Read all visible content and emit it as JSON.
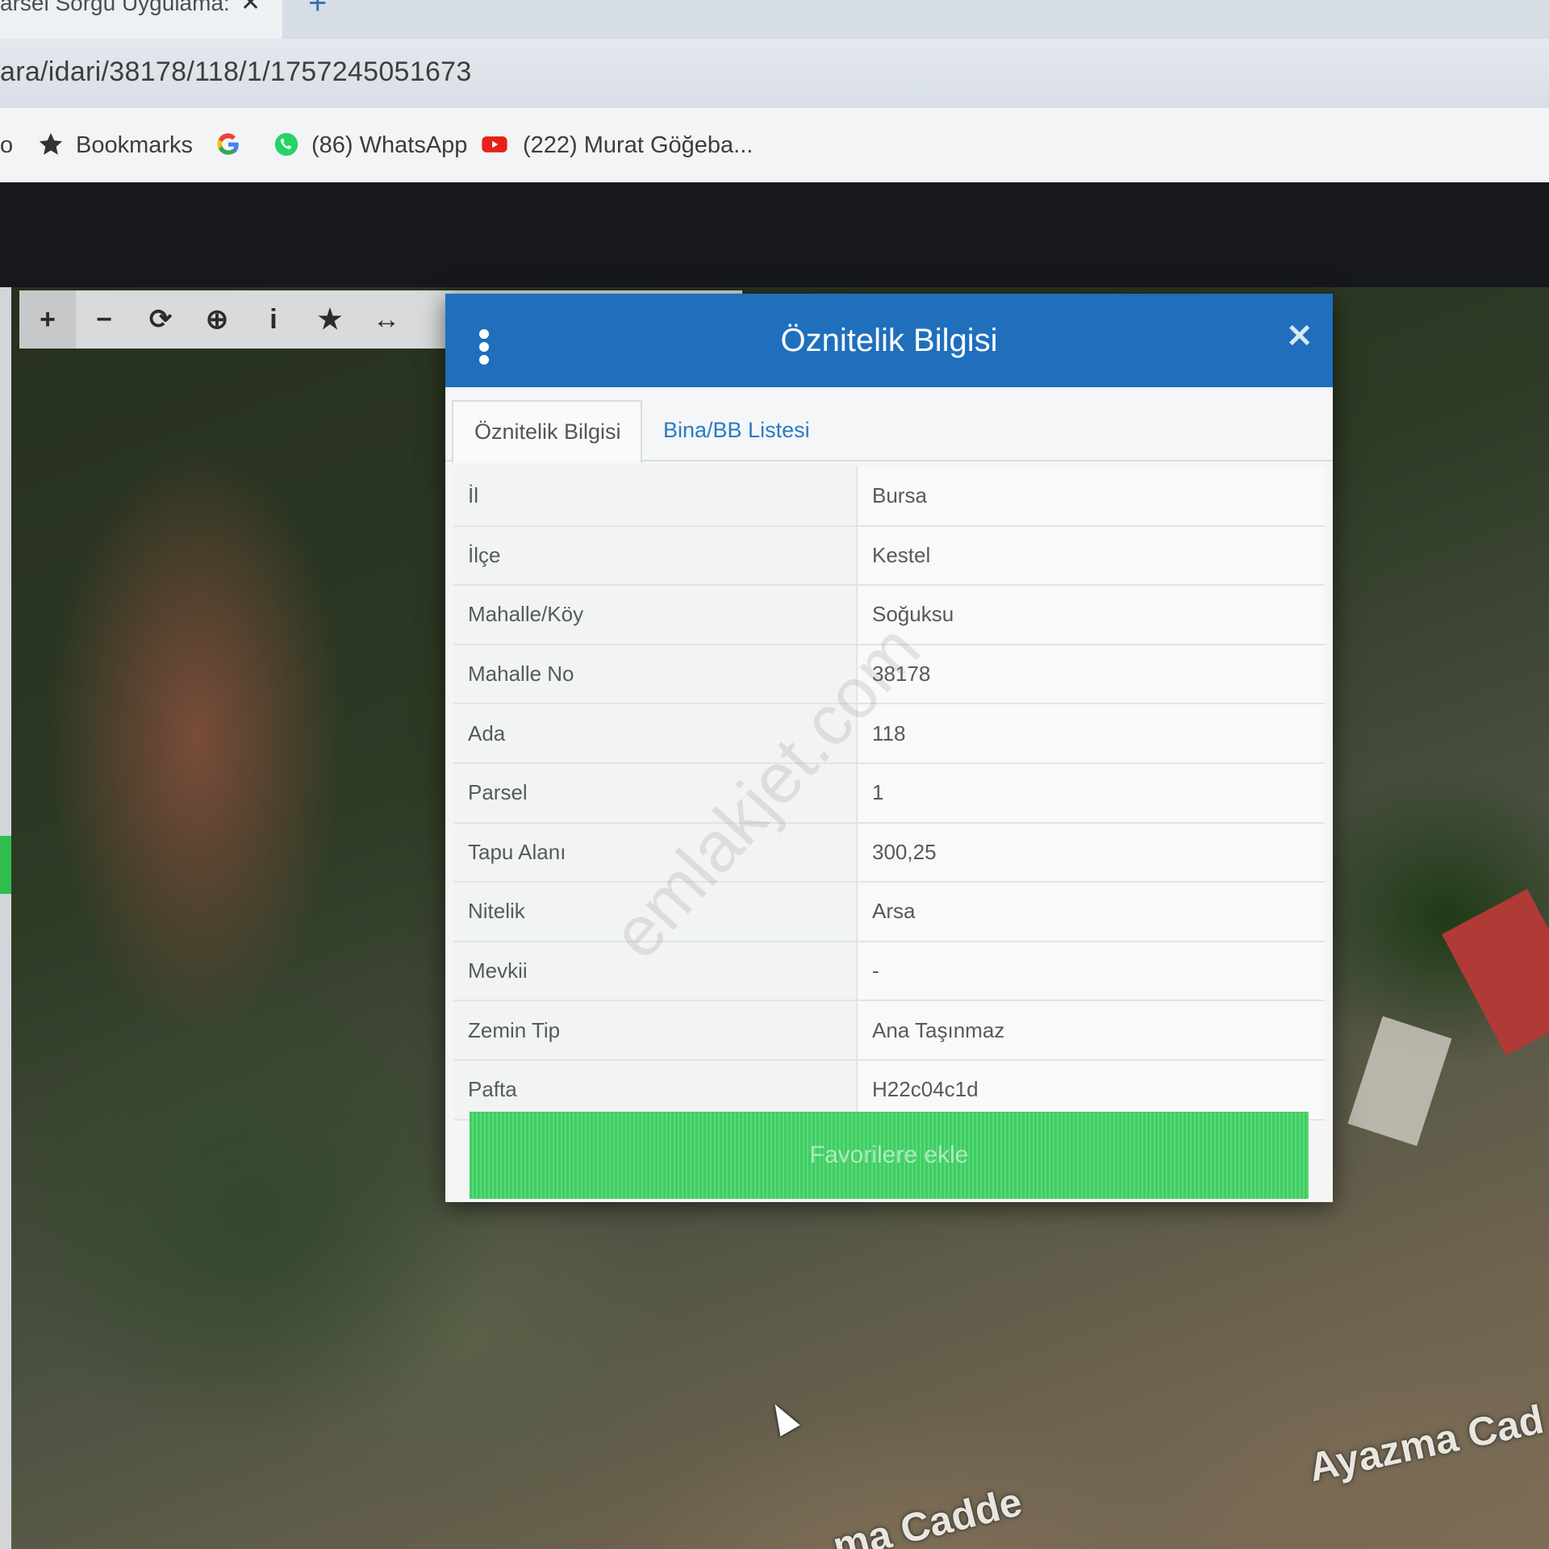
{
  "browser": {
    "tab_title": "arsel Sorgu Uygulama:",
    "tab_close": "✕",
    "tab_new": "+",
    "url": "ara/idari/38178/118/1/1757245051673",
    "bookmarks": [
      {
        "label": "Bookmarks",
        "icon": "star-icon"
      },
      {
        "label": "",
        "icon": "google-icon"
      },
      {
        "label": "(86) WhatsApp",
        "icon": "whatsapp-icon"
      },
      {
        "label": "(222) Murat Göğeba...",
        "icon": "youtube-icon"
      }
    ],
    "bookmark_prefix": "o"
  },
  "toolbar": {
    "tools": [
      {
        "icon": "zoom-in-icon",
        "glyph": "+"
      },
      {
        "icon": "zoom-out-icon",
        "glyph": "−"
      },
      {
        "icon": "refresh-icon",
        "glyph": "⟳"
      },
      {
        "icon": "locate-icon",
        "glyph": "⊕"
      },
      {
        "icon": "info-icon",
        "glyph": "i"
      },
      {
        "icon": "favorite-star-icon",
        "glyph": "★"
      },
      {
        "icon": "measure-icon",
        "glyph": "↔"
      }
    ]
  },
  "dialog": {
    "title": "Öznitelik Bilgisi",
    "close": "✕",
    "tabs": [
      "Öznitelik Bilgisi",
      "Bina/BB Listesi"
    ],
    "rows": [
      {
        "key": "İl",
        "value": "Bursa"
      },
      {
        "key": "İlçe",
        "value": "Kestel"
      },
      {
        "key": "Mahalle/Köy",
        "value": "Soğuksu"
      },
      {
        "key": "Mahalle No",
        "value": "38178"
      },
      {
        "key": "Ada",
        "value": "118"
      },
      {
        "key": "Parsel",
        "value": "1"
      },
      {
        "key": "Tapu Alanı",
        "value": "300,25"
      },
      {
        "key": "Nitelik",
        "value": "Arsa"
      },
      {
        "key": "Mevkii",
        "value": "-"
      },
      {
        "key": "Zemin Tip",
        "value": "Ana Taşınmaz"
      },
      {
        "key": "Pafta",
        "value": "H22c04c1d"
      }
    ],
    "favorite_button": "Favorilere ekle"
  },
  "watermark": "emlakjet.com",
  "map_labels": {
    "road1": "Ayazma Cad",
    "road2": "ma Cadde"
  },
  "colors": {
    "dialog_header": "#1f6fbd",
    "favorite_button": "#3fcd62",
    "tab_link": "#2a7bc4"
  }
}
